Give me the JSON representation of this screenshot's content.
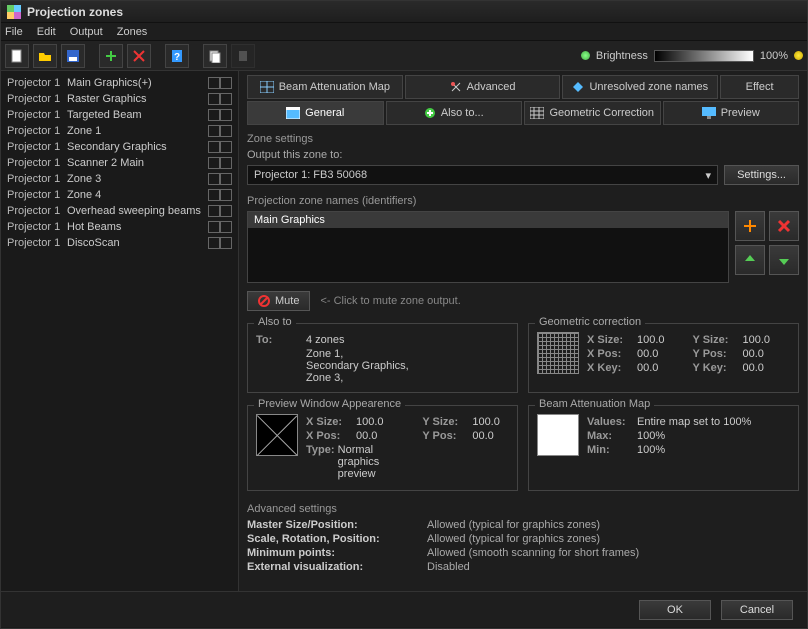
{
  "window": {
    "title": "Projection zones"
  },
  "menu": {
    "file": "File",
    "edit": "Edit",
    "output": "Output",
    "zones": "Zones"
  },
  "brightness": {
    "label": "Brightness",
    "value": "100%"
  },
  "zone_list": [
    {
      "projector": "Projector 1",
      "name": "Main Graphics(+)"
    },
    {
      "projector": "Projector 1",
      "name": "Raster Graphics"
    },
    {
      "projector": "Projector 1",
      "name": "Targeted Beam"
    },
    {
      "projector": "Projector 1",
      "name": "Zone 1"
    },
    {
      "projector": "Projector 1",
      "name": "Secondary Graphics"
    },
    {
      "projector": "Projector 1",
      "name": "Scanner 2 Main"
    },
    {
      "projector": "Projector 1",
      "name": "Zone 3"
    },
    {
      "projector": "Projector 1",
      "name": "Zone 4"
    },
    {
      "projector": "Projector 1",
      "name": "Overhead sweeping beams"
    },
    {
      "projector": "Projector 1",
      "name": "Hot Beams"
    },
    {
      "projector": "Projector 1",
      "name": "DiscoScan"
    }
  ],
  "tabs_top": {
    "beam": "Beam Attenuation Map",
    "advanced": "Advanced",
    "unresolved": "Unresolved zone names",
    "effect": "Effect"
  },
  "tabs_bottom": {
    "general": "General",
    "also_to": "Also to...",
    "geo": "Geometric Correction",
    "preview": "Preview"
  },
  "zone_settings": {
    "title": "Zone settings",
    "output_label": "Output this zone to:",
    "output_value": "Projector 1: FB3 50068",
    "settings_btn": "Settings..."
  },
  "zone_names": {
    "title": "Projection zone names (identifiers)",
    "selected": "Main Graphics"
  },
  "mute": {
    "btn": "Mute",
    "hint": "<- Click to mute zone output."
  },
  "also": {
    "legend": "Also to",
    "to_label": "To:",
    "to_value": "4 zones",
    "lines": [
      "Zone 1,",
      "Secondary Graphics,",
      "Zone 3,"
    ]
  },
  "geo": {
    "legend": "Geometric correction",
    "xsize_k": "X Size:",
    "xsize_v": "100.0",
    "ysize_k": "Y Size:",
    "ysize_v": "100.0",
    "xpos_k": "X Pos:",
    "xpos_v": "00.0",
    "ypos_k": "Y Pos:",
    "ypos_v": "00.0",
    "xkey_k": "X Key:",
    "xkey_v": "00.0",
    "ykey_k": "Y Key:",
    "ykey_v": "00.0"
  },
  "preview": {
    "legend": "Preview Window Appearence",
    "xsize_k": "X Size:",
    "xsize_v": "100.0",
    "ysize_k": "Y Size:",
    "ysize_v": "100.0",
    "xpos_k": "X Pos:",
    "xpos_v": "00.0",
    "ypos_k": "Y Pos:",
    "ypos_v": "00.0",
    "type_k": "Type:",
    "type_v": "Normal graphics preview"
  },
  "bam": {
    "legend": "Beam Attenuation Map",
    "values_k": "Values:",
    "values_v": "Entire map set to 100%",
    "max_k": "Max:",
    "max_v": "100%",
    "min_k": "Min:",
    "min_v": "100%"
  },
  "advanced": {
    "title": "Advanced settings",
    "r1k": "Master Size/Position:",
    "r1v": "Allowed (typical for graphics zones)",
    "r2k": "Scale, Rotation, Position:",
    "r2v": "Allowed (typical for graphics zones)",
    "r3k": "Minimum points:",
    "r3v": "Allowed (smooth scanning for short frames)",
    "r4k": "External visualization:",
    "r4v": "Disabled"
  },
  "footer": {
    "ok": "OK",
    "cancel": "Cancel"
  }
}
